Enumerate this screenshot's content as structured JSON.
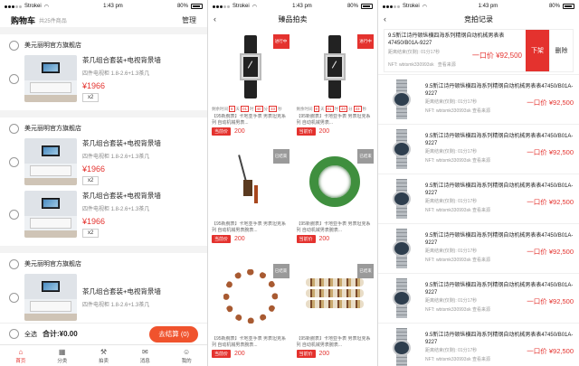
{
  "status": {
    "carrier": "Strokei",
    "time": "1:43 pm",
    "battery": "80%"
  },
  "cart": {
    "title": "购物车",
    "count": "共25件商品",
    "manage": "管理",
    "stores": [
      {
        "name": "美元丽明官方旗舰店",
        "items": [
          {
            "name": "茶几组合套装+电视背景墙",
            "spec": "四件电视柜 1.8-2.6+1.3茶几",
            "price": "¥1966",
            "qty": "x2"
          }
        ]
      },
      {
        "name": "美元丽明官方旗舰店",
        "items": [
          {
            "name": "茶几组合套装+电视背景墙",
            "spec": "四件电视柜 1.8-2.6+1.3茶几",
            "price": "¥1966",
            "qty": "x2"
          },
          {
            "name": "茶几组合套装+电视背景墙",
            "spec": "四件电视柜 1.8-2.6+1.3茶几",
            "price": "¥1966",
            "qty": "x2"
          }
        ]
      },
      {
        "name": "美元丽明官方旗舰店",
        "items": [
          {
            "name": "茶几组合套装+电视背景墙",
            "spec": "四件电视柜 1.8-2.6+1.3茶几"
          }
        ]
      }
    ],
    "footer": {
      "select_all": "全选",
      "total": "合计:¥0.00",
      "checkout": "去结算 (0)"
    },
    "tabs": [
      {
        "label": "首页",
        "icon": "home-icon",
        "active": true
      },
      {
        "label": "分类",
        "icon": "grid-icon",
        "active": false
      },
      {
        "label": "拍卖",
        "icon": "auction-icon",
        "active": false
      },
      {
        "label": "消息",
        "icon": "message-icon",
        "active": false
      },
      {
        "label": "我的",
        "icon": "user-icon",
        "active": false
      }
    ]
  },
  "auction": {
    "title": "臻品拍卖",
    "cards": [
      {
        "badge": "进行中",
        "badge_type": "live",
        "timer": [
          "8",
          "01",
          "40",
          "33"
        ],
        "timer_prefix": "剩余时间",
        "timer_units": [
          "天",
          "时",
          "分",
          "秒"
        ],
        "desc": "【95新腕表】卡地亚手表 男表坦克系列 自动机械男表...",
        "price_label": "当前价",
        "price": "200",
        "image": "watch"
      },
      {
        "badge": "进行中",
        "badge_type": "live",
        "timer": [
          "8",
          "01",
          "40",
          "33"
        ],
        "timer_prefix": "剩余时间",
        "timer_units": [
          "天",
          "时",
          "分",
          "秒"
        ],
        "desc": "【95新腕表】卡地亚手表 男表坦克系列 自动机械男表...",
        "price_label": "当前价",
        "price": "200",
        "image": "watch"
      },
      {
        "badge": "已结束",
        "badge_type": "done",
        "desc": "【95新腕表】卡地亚手表 男表坦克系列 自动机械男表腕表...",
        "price_label": "当前价",
        "price": "200",
        "image": "tassel"
      },
      {
        "badge": "已结束",
        "badge_type": "done",
        "desc": "【95新腕表】卡地亚手表 男表坦克系列 自动机械男表腕表...",
        "price_label": "当前价",
        "price": "200",
        "image": "bangle"
      },
      {
        "badge": "已结束",
        "badge_type": "done",
        "desc": "【95新腕表】卡地亚手表 男表坦克系列 自动机械男表腕表...",
        "price_label": "当前价",
        "price": "200",
        "image": "beads"
      },
      {
        "badge": "已结束",
        "badge_type": "done",
        "desc": "【95新腕表】卡地亚手表 男表坦克系列 自动机械男表腕表...",
        "price_label": "当前价",
        "price": "200",
        "image": "bracelets"
      }
    ]
  },
  "bids": {
    "title": "竞拍记录",
    "top": {
      "name": "9.5新江诗丹顿纵横四海系列精钢自动机械男表表47450/B01A-9227",
      "meta": "距离结束(仅剩): 01分17秒",
      "bid": "一口价 ¥92,500",
      "nft": "NFT: wbtsmk330993sk",
      "view": "查看来源",
      "action1": "下架",
      "action2": "删除"
    },
    "records": [
      {
        "name": "9.5新江诗丹顿纵横四海系列精钢自动机械男表表47450/B01A-9227",
        "meta": "距离结束(仅剩): 01分17秒",
        "bid": "一口价 ¥92,500",
        "nft": "NFT: wbtsmk330993sk",
        "view": "查看来源"
      },
      {
        "name": "9.5新江诗丹顿纵横四海系列精钢自动机械男表表47450/B01A-9227",
        "meta": "距离结束(仅剩): 01分17秒",
        "bid": "一口价 ¥92,500",
        "nft": "NFT: wbtsmk330993sk",
        "view": "查看来源"
      },
      {
        "name": "9.5新江诗丹顿纵横四海系列精钢自动机械男表表47450/B01A-9227",
        "meta": "距离结束(仅剩): 01分17秒",
        "bid": "一口价 ¥92,500",
        "nft": "NFT: wbtsmk330993sk",
        "view": "查看来源"
      },
      {
        "name": "9.5新江诗丹顿纵横四海系列精钢自动机械男表表47450/B01A-9227",
        "meta": "距离结束(仅剩): 01分17秒",
        "bid": "一口价 ¥92,500",
        "nft": "NFT: wbtsmk330993sk",
        "view": "查看来源"
      },
      {
        "name": "9.5新江诗丹顿纵横四海系列精钢自动机械男表表47450/B01A-9227",
        "meta": "距离结束(仅剩): 01分17秒",
        "bid": "一口价 ¥92,500",
        "nft": "NFT: wbtsmk330993sk",
        "view": "查看来源"
      },
      {
        "name": "9.5新江诗丹顿纵横四海系列精钢自动机械男表表47450/B01A-9227",
        "meta": "距离结束(仅剩): 01分17秒",
        "bid": "一口价 ¥92,500",
        "nft": "NFT: wbtsmk330993sk",
        "view": "查看来源"
      }
    ]
  },
  "colors": {
    "accent": "#e4322e",
    "checkout": "#f0532d"
  }
}
